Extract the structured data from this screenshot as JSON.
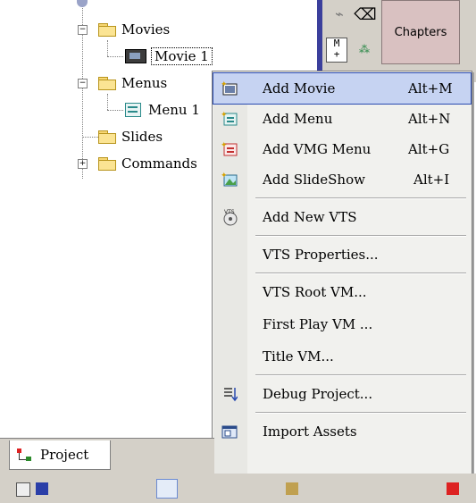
{
  "tree": {
    "movies_label": "Movies",
    "movie1_label": "Movie 1",
    "menus_label": "Menus",
    "menu1_label": "Menu 1",
    "slides_label": "Slides",
    "commands_label": "Commands"
  },
  "toolbar": {
    "chapters_label": "Chapters"
  },
  "context_menu": {
    "items": [
      {
        "label": "Add Movie",
        "shortcut": "Alt+M",
        "icon": "add-movie-icon"
      },
      {
        "label": "Add Menu",
        "shortcut": "Alt+N",
        "icon": "add-menu-icon"
      },
      {
        "label": "Add VMG Menu",
        "shortcut": "Alt+G",
        "icon": "add-vmg-menu-icon"
      },
      {
        "label": "Add SlideShow",
        "shortcut": "Alt+I",
        "icon": "add-slideshow-icon"
      },
      {
        "label": "Add New VTS",
        "shortcut": "",
        "icon": "add-vts-icon"
      },
      {
        "label": "VTS Properties...",
        "shortcut": "",
        "icon": ""
      },
      {
        "label": "VTS Root VM...",
        "shortcut": "",
        "icon": ""
      },
      {
        "label": "First Play VM ...",
        "shortcut": "",
        "icon": ""
      },
      {
        "label": "Title VM...",
        "shortcut": "",
        "icon": ""
      },
      {
        "label": "Debug Project...",
        "shortcut": "",
        "icon": "debug-icon"
      },
      {
        "label": "Import Assets",
        "shortcut": "",
        "icon": "import-icon"
      }
    ]
  },
  "tabs": {
    "project_label": "Project"
  },
  "colors": {
    "highlight_bg": "#c6d3f2",
    "highlight_border": "#2a4bb0",
    "chapters_bg": "#d9c1c1"
  }
}
